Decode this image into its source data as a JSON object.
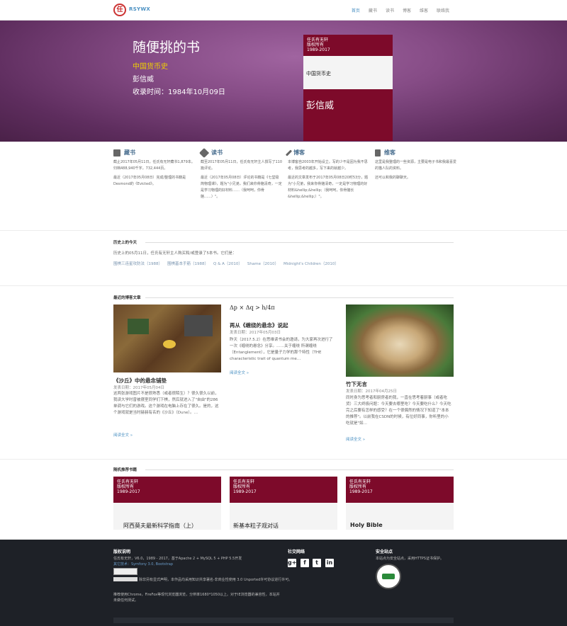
{
  "nav": {
    "logo_char": "任",
    "brand": "RSYWX",
    "items": [
      "首页",
      "藏书",
      "读书",
      "博客",
      "维客",
      "联络我"
    ]
  },
  "hero": {
    "title": "随便挑的书",
    "book_title": "中国货币史",
    "author": "彭信威",
    "collected": "收录时间：1984年10月09日",
    "cover_copyright": "任氏有无轩\n版权所有\n1989-2017",
    "cover_title": "中国货币史",
    "cover_author": "彭信威"
  },
  "features": [
    {
      "icon": "book-icon",
      "title": "藏书",
      "text1": "截止2017年05月11日，任氏有无轩藏书1,879本。归档488,940千字，732,444页。",
      "text2": "最近（2017年05月08日）完成/整理的书籍是Desmond的《Evicted》。"
    },
    {
      "icon": "tag-icon",
      "title": "读书",
      "text1": "截至2017年05月11日，任氏有无轩主人撰写了110篇评论。",
      "text2": "最近（2017年05月08日）评论的书籍是《七堂极简物理课》，题为\"小兄弟，我们来你骨骼清奇，一定是学习物理的好材料……（我呵呵，你骨骼……）\"。"
    },
    {
      "icon": "pencil-icon",
      "title": "博客",
      "text1": "本博客自2003年开始设立。写的少不是因为我不思考，我思考的越多，写下来的就越少。",
      "text2": "最近的文章发布于2017年05月08日20时53分，题为\"小兄弟，我来你骨骼清奇，一定是学习物理的好材料&hellip;&hellip;（我呵呵，你骨骼长&hellip;&hellip;）\"。"
    },
    {
      "icon": "clipboard-icon",
      "title": "维客",
      "text1": "这里是我整理的一些资源，主要是电子书和我最喜爱的猫人队的资料。",
      "text2": "还可以和我的聊聊天。"
    }
  ],
  "history": {
    "title": "历史上的今天",
    "text": "历史上的05月11日，任氏有无轩主人购买和/或登录了5本书。它们是：",
    "links": [
      "围棋三连星攻防法（1988）",
      "围棋基本手筋（1988）",
      "Q & A（2010）",
      "Shame（2010）",
      "Midnight's Children（2010）"
    ]
  },
  "recent": {
    "title": "最近的博客文章",
    "articles": [
      {
        "title": "《沙丘》中的悬念铺垫",
        "date": "发表日期：2017年05月04日",
        "excerpt": "这两张游戏图片不是很熟悉（或者很陌生）？很久很久以前，我读大学时曾被寝室同学们下棋，然后就进入了\"自由\"的286单调与它们的游戏。这个游戏在电脑上存在了很久。是的，这个游戏就是当时赫赫有名的《沙丘》（Dune）。…",
        "more": "阅读全文 »"
      },
      {
        "formula": "Δp × Δq > h/4π",
        "title": "再从《缠绕的悬念》说起",
        "date": "发表日期：2017年05月03日",
        "excerpt": "昨天（2017.5.2）在思维读书会的邀请，为大家再次进行了一次《缠绕的悬念》分享。……关于缠绕 所谓缠绕（Entanglement），它是量子力学的那个特性（THE characteristic trait of quantum me…",
        "more": "阅读全文 »"
      },
      {
        "title": "竹下无言",
        "date": "发表日期：2017年04月25日",
        "excerpt": "同时身为思考者和厨房者的我，一直在思考着厨事（或者吃货）三大终极问题：今天要去哪里吃？今天要吃什么？今天吃完之后要有怎样的感受？在一个很偶然的情况下知道了\"本本的推荐\"。以前我在CSDN的时候，有位好同事，你听里的小吃就是\"如…",
        "more": "阅读全文 »"
      }
    ]
  },
  "random_books": {
    "title": "随机推荐书籍",
    "cover_copyright": "任氏有无轩\n版权所有\n1989-2017",
    "books": [
      "阿西莫夫最新科学指南（上）",
      "新基本粒子观对话",
      "Holy Bible"
    ]
  },
  "footer": {
    "col1_title": "版权说明",
    "col1_line1": "任氏有无轩，V6.0，1989 - 2017，基于Apache 2 + MySQL 5 + PHP 5.5开发",
    "col1_line2": "其它技术：Symfony 3.0, Bootstrap",
    "col1_line3": "除非另有显式声明，本作品均采用知识共享署名-非商业性使用 3.0 Unported许可协议进行许可。",
    "col1_line4": "推荐使用Chrome，FireFox等现代浏览器浏览，分辨率1680*1050以上。对于IE浏览器的兼容性，本站并未做任何测试。",
    "col2_title": "社交网络",
    "col3_title": "安全站点",
    "col3_text": "本站点为安全站点，采用HTTPS证书保护。",
    "social": [
      "g+",
      "f",
      "t",
      "in"
    ]
  }
}
